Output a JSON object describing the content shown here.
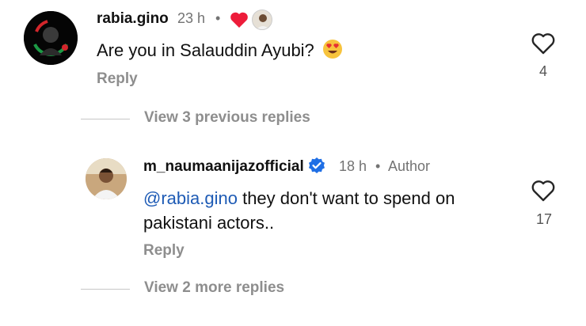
{
  "comments": [
    {
      "username": "rabia.gino",
      "time": "23 h",
      "separator": "•",
      "text": "Are you in Salauddin Ayubi?",
      "emoji": "heart-eyes-emoji",
      "reply_label": "Reply",
      "like_count": "4",
      "reaction_icons": [
        "red-heart-icon",
        "small-user-avatar"
      ]
    },
    {
      "username": "m_naumaanijazofficial",
      "verified": true,
      "time": "18 h",
      "separator": "•",
      "author_badge": "Author",
      "mention": "@rabia.gino",
      "text_line1": " they don't want to spend on",
      "text_line2": "pakistani actors..",
      "reply_label": "Reply",
      "like_count": "17"
    }
  ],
  "view_previous": "View 3 previous replies",
  "view_more": "View 2 more replies",
  "colors": {
    "mention": "#1e5bb5",
    "verified": "#1f6fe5",
    "heart": "#ed1c3a",
    "muted": "#8e8e8e"
  }
}
